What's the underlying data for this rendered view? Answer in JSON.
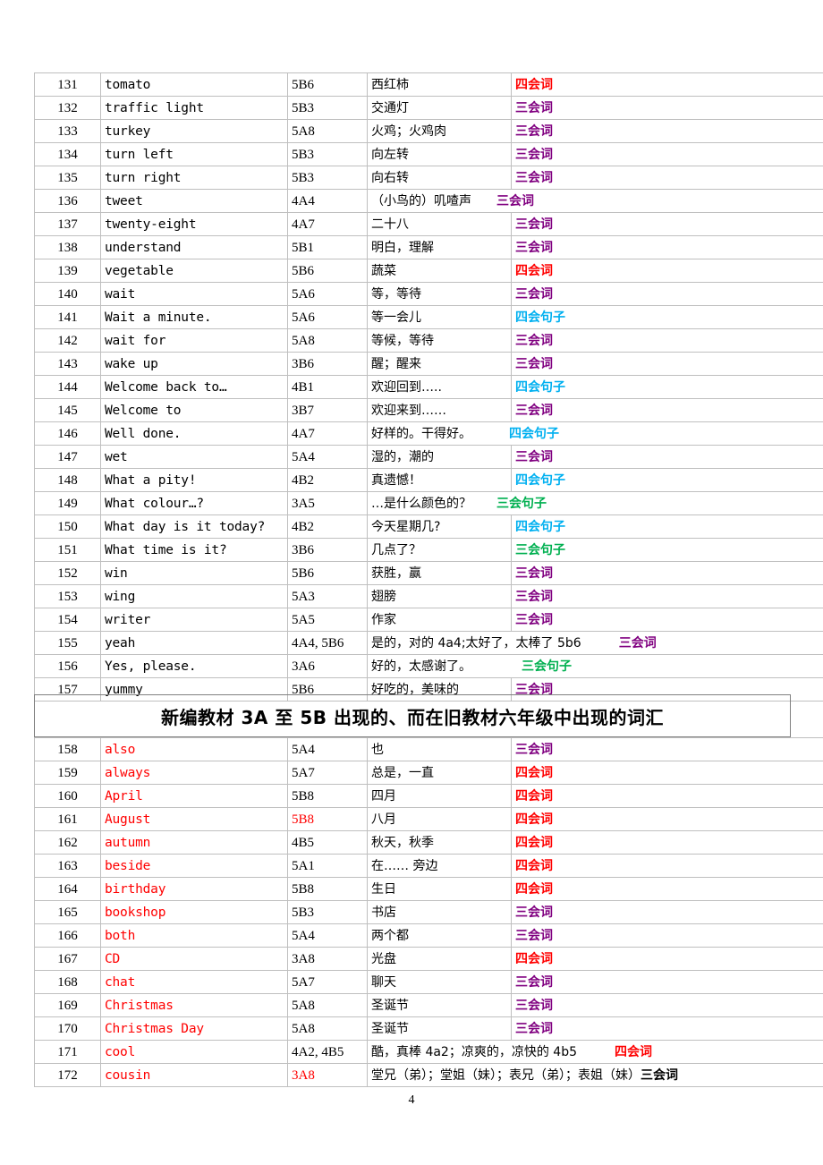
{
  "page": {
    "number": "4"
  },
  "legend_colors": {
    "four_skills_word": "#FF0000",
    "three_skills_word": "#800080",
    "four_skills_sentence": "#00B0F0",
    "three_skills_sentence": "#00B050"
  },
  "section_banner": {
    "title": "新编教材 3A 至 5B 出现的、而在旧教材六年级中出现的词汇"
  },
  "table_one": {
    "rows": [
      {
        "idx": "131",
        "word": "tomato",
        "code": "5B6",
        "meaning": "西红柿",
        "note": "四会词",
        "note_class": "tag-4w",
        "merged": false,
        "word_red": false,
        "code_red": false
      },
      {
        "idx": "132",
        "word": "traffic light",
        "code": "5B3",
        "meaning": "交通灯",
        "note": "三会词",
        "note_class": "tag-3w",
        "merged": false,
        "word_red": false,
        "code_red": false
      },
      {
        "idx": "133",
        "word": "turkey",
        "code": "5A8",
        "meaning": "火鸡；火鸡肉",
        "note": "三会词",
        "note_class": "tag-3w",
        "merged": false,
        "word_red": false,
        "code_red": false
      },
      {
        "idx": "134",
        "word": "turn left",
        "code": "5B3",
        "meaning": "向左转",
        "note": "三会词",
        "note_class": "tag-3w",
        "merged": false,
        "word_red": false,
        "code_red": false
      },
      {
        "idx": "135",
        "word": "turn right",
        "code": "5B3",
        "meaning": "向右转",
        "note": "三会词",
        "note_class": "tag-3w",
        "merged": false,
        "word_red": false,
        "code_red": false
      },
      {
        "idx": "136",
        "word": "tweet",
        "code": "4A4",
        "meaning": "（小鸟的）叽喳声",
        "note": "三会词",
        "note_class": "tag-3w",
        "merged": true,
        "pad": "pad-sm",
        "word_red": false,
        "code_red": false
      },
      {
        "idx": "137",
        "word": "twenty-eight",
        "code": "4A7",
        "meaning": "二十八",
        "note": "三会词",
        "note_class": "tag-3w",
        "merged": false,
        "word_red": false,
        "code_red": false
      },
      {
        "idx": "138",
        "word": "understand",
        "code": "5B1",
        "meaning": "明白，理解",
        "note": "三会词",
        "note_class": "tag-3w",
        "merged": false,
        "word_red": false,
        "code_red": false
      },
      {
        "idx": "139",
        "word": "vegetable",
        "code": "5B6",
        "meaning": "蔬菜",
        "note": "四会词",
        "note_class": "tag-4w",
        "merged": false,
        "word_red": false,
        "code_red": false
      },
      {
        "idx": "140",
        "word": "wait",
        "code": "5A6",
        "meaning": "等，等待",
        "note": "三会词",
        "note_class": "tag-3w",
        "merged": false,
        "word_red": false,
        "code_red": false
      },
      {
        "idx": "141",
        "word": "Wait a minute.",
        "code": "5A6",
        "meaning": "等一会儿",
        "note": "四会句子",
        "note_class": "tag-4s",
        "merged": false,
        "word_red": false,
        "code_red": false
      },
      {
        "idx": "142",
        "word": "wait for",
        "code": "5A8",
        "meaning": "等候，等待",
        "note": "三会词",
        "note_class": "tag-3w",
        "merged": false,
        "word_red": false,
        "code_red": false
      },
      {
        "idx": "143",
        "word": "wake up",
        "code": "3B6",
        "meaning": "醒；醒来",
        "note": "三会词",
        "note_class": "tag-3w",
        "merged": false,
        "word_red": false,
        "code_red": false
      },
      {
        "idx": "144",
        "word": "Welcome back to…",
        "code": "4B1",
        "meaning": "欢迎回到…..",
        "note": "四会句子",
        "note_class": "tag-4s",
        "merged": false,
        "word_red": false,
        "code_red": false
      },
      {
        "idx": "145",
        "word": "Welcome to",
        "code": "3B7",
        "meaning": "欢迎来到……",
        "note": "三会词",
        "note_class": "tag-3w",
        "merged": false,
        "word_red": false,
        "code_red": false
      },
      {
        "idx": "146",
        "word": "Well done.",
        "code": "4A7",
        "meaning": "好样的。干得好。",
        "note": "四会句子",
        "note_class": "tag-4s",
        "merged": true,
        "pad": "pad-md",
        "word_red": false,
        "code_red": false
      },
      {
        "idx": "147",
        "word": "wet",
        "code": "5A4",
        "meaning": "湿的，潮的",
        "note": "三会词",
        "note_class": "tag-3w",
        "merged": false,
        "word_red": false,
        "code_red": false
      },
      {
        "idx": "148",
        "word": "What a pity!",
        "code": "4B2",
        "meaning": "真遗憾！",
        "note": "四会句子",
        "note_class": "tag-4s",
        "merged": false,
        "word_red": false,
        "code_red": false
      },
      {
        "idx": "149",
        "word": "What colour…?",
        "code": "3A5",
        "meaning": "…是什么颜色的？",
        "note": "三会句子",
        "note_class": "tag-3s",
        "merged": true,
        "pad": "pad-sm",
        "word_red": false,
        "code_red": false
      },
      {
        "idx": "150",
        "word": "What day is it today?",
        "code": "4B2",
        "meaning": "今天星期几?",
        "note": "四会句子",
        "note_class": "tag-4s",
        "merged": false,
        "word_red": false,
        "code_red": false
      },
      {
        "idx": "151",
        "word": "What time is it?",
        "code": "3B6",
        "meaning": "几点了？",
        "note": "三会句子",
        "note_class": "tag-3s",
        "merged": false,
        "word_red": false,
        "code_red": false
      },
      {
        "idx": "152",
        "word": "win",
        "code": "5B6",
        "meaning": "获胜，赢",
        "note": "三会词",
        "note_class": "tag-3w",
        "merged": false,
        "word_red": false,
        "code_red": false
      },
      {
        "idx": "153",
        "word": "wing",
        "code": "5A3",
        "meaning": "翅膀",
        "note": "三会词",
        "note_class": "tag-3w",
        "merged": false,
        "word_red": false,
        "code_red": false
      },
      {
        "idx": "154",
        "word": "writer",
        "code": "5A5",
        "meaning": "作家",
        "note": "三会词",
        "note_class": "tag-3w",
        "merged": false,
        "word_red": false,
        "code_red": false
      },
      {
        "idx": "155",
        "word": "yeah",
        "code": "4A4, 5B6",
        "meaning": "是的，对的 4a4;太好了，太棒了 5b6",
        "note": "三会词",
        "note_class": "tag-3w",
        "merged": true,
        "pad": "pad-md",
        "word_red": false,
        "code_red": false
      },
      {
        "idx": "156",
        "word": "Yes, please.",
        "code": "3A6",
        "meaning": "好的，太感谢了。",
        "note": "三会句子",
        "note_class": "tag-3s",
        "merged": true,
        "pad": "pad-lg",
        "word_red": false,
        "code_red": false
      },
      {
        "idx": "157",
        "word": "yummy",
        "code": "5B6",
        "meaning": "好吃的，美味的",
        "note": "三会词",
        "note_class": "tag-3w",
        "merged": false,
        "word_red": false,
        "code_red": false
      }
    ]
  },
  "table_two": {
    "rows": [
      {
        "idx": "158",
        "word": "also",
        "code": "5A4",
        "meaning": "也",
        "note": "三会词",
        "note_class": "tag-3w",
        "merged": false,
        "word_red": true,
        "code_red": false
      },
      {
        "idx": "159",
        "word": "always",
        "code": "5A7",
        "meaning": "总是，一直",
        "note": "四会词",
        "note_class": "tag-4w",
        "merged": false,
        "word_red": true,
        "code_red": false
      },
      {
        "idx": "160",
        "word": "April",
        "code": "5B8",
        "meaning": "四月",
        "note": "四会词",
        "note_class": "tag-4w",
        "merged": false,
        "word_red": true,
        "code_red": false
      },
      {
        "idx": "161",
        "word": "August",
        "code": "5B8",
        "meaning": "八月",
        "note": "四会词",
        "note_class": "tag-4w",
        "merged": false,
        "word_red": true,
        "code_red": true
      },
      {
        "idx": "162",
        "word": "autumn",
        "code": "4B5",
        "meaning": "秋天，秋季",
        "note": "四会词",
        "note_class": "tag-4w",
        "merged": false,
        "word_red": true,
        "code_red": false
      },
      {
        "idx": "163",
        "word": "beside",
        "code": "5A1",
        "meaning": "在…… 旁边",
        "note": "四会词",
        "note_class": "tag-4w",
        "merged": false,
        "word_red": true,
        "code_red": false
      },
      {
        "idx": "164",
        "word": "birthday",
        "code": "5B8",
        "meaning": "生日",
        "note": "四会词",
        "note_class": "tag-4w",
        "merged": false,
        "word_red": true,
        "code_red": false
      },
      {
        "idx": "165",
        "word": "bookshop",
        "code": "5B3",
        "meaning": "书店",
        "note": "三会词",
        "note_class": "tag-3w",
        "merged": false,
        "word_red": true,
        "code_red": false
      },
      {
        "idx": "166",
        "word": "both",
        "code": "5A4",
        "meaning": "两个都",
        "note": "三会词",
        "note_class": "tag-3w",
        "merged": false,
        "word_red": true,
        "code_red": false
      },
      {
        "idx": "167",
        "word": "CD",
        "code": "3A8",
        "meaning": "光盘",
        "note": "四会词",
        "note_class": "tag-4w",
        "merged": false,
        "word_red": true,
        "code_red": false
      },
      {
        "idx": "168",
        "word": "chat",
        "code": "5A7",
        "meaning": "聊天",
        "note": "三会词",
        "note_class": "tag-3w",
        "merged": false,
        "word_red": true,
        "code_red": false
      },
      {
        "idx": "169",
        "word": "Christmas",
        "code": "5A8",
        "meaning": "圣诞节",
        "note": "三会词",
        "note_class": "tag-3w",
        "merged": false,
        "word_red": true,
        "code_red": false
      },
      {
        "idx": "170",
        "word": "Christmas Day",
        "code": "5A8",
        "meaning": "圣诞节",
        "note": "三会词",
        "note_class": "tag-3w",
        "merged": false,
        "word_red": true,
        "code_red": false
      },
      {
        "idx": "171",
        "word": "cool",
        "code": "4A2, 4B5",
        "meaning": "酷，真棒 4a2；凉爽的，凉快的 4b5",
        "note": "四会词",
        "note_class": "tag-4w",
        "merged": true,
        "pad": "pad-md",
        "word_red": true,
        "code_red": false
      },
      {
        "idx": "172",
        "word": "cousin",
        "code": "3A8",
        "meaning": "堂兄（弟）；堂姐（妹）；表兄（弟）；表姐（妹）",
        "note": "三会词",
        "note_class": "tag-blk",
        "merged": true,
        "pad": "pad-none",
        "word_red": true,
        "code_red": true
      }
    ]
  }
}
